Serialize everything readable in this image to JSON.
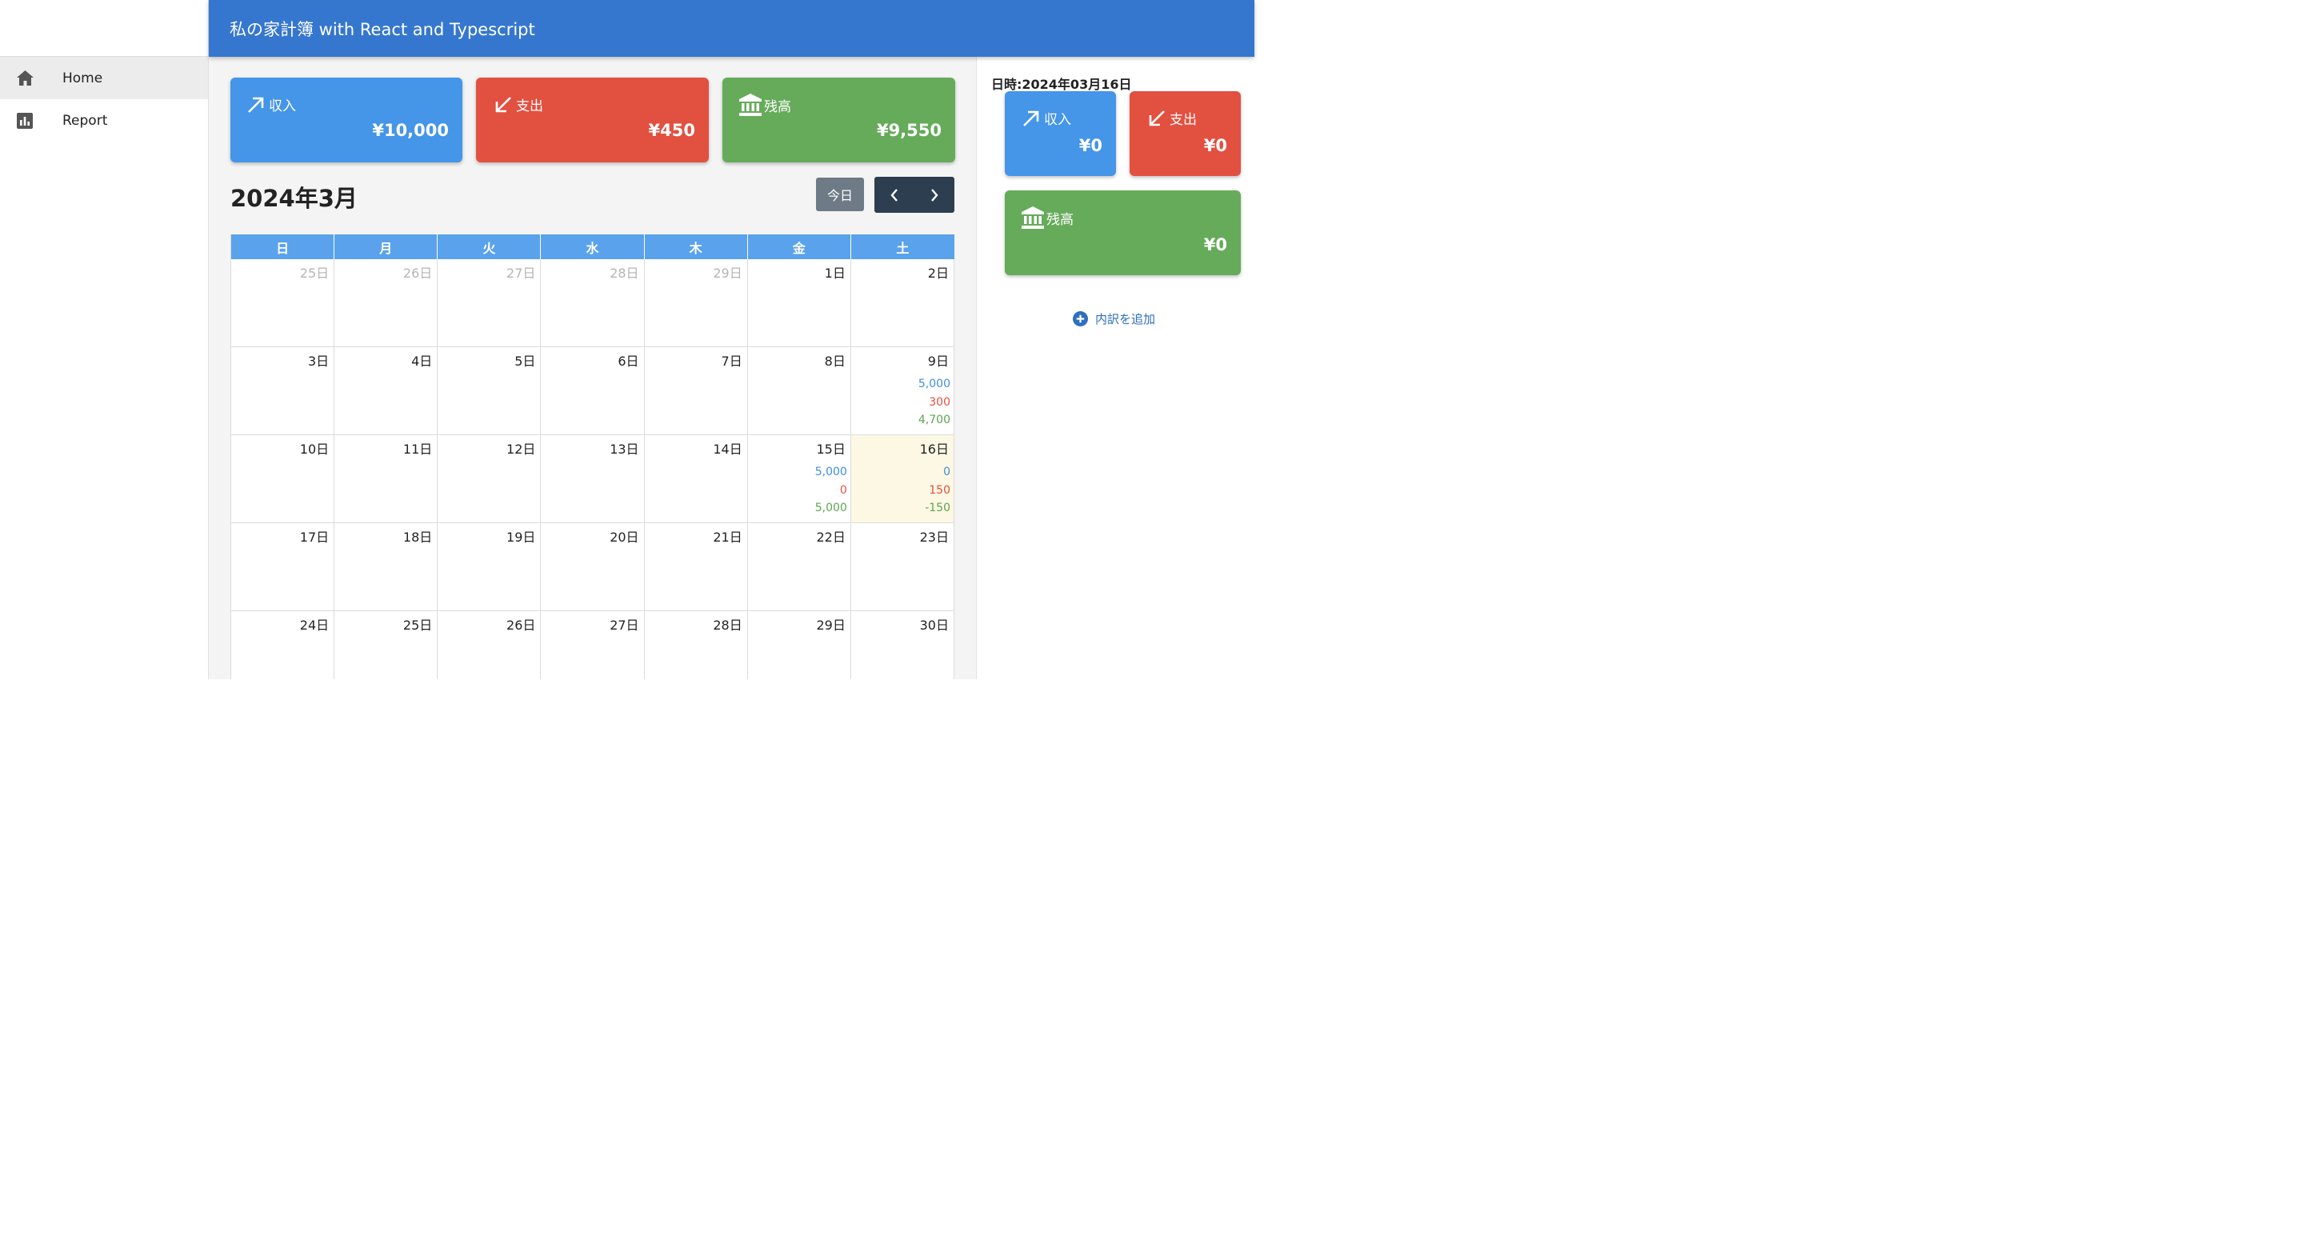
{
  "header": {
    "title": "私の家計簿 with React and Typescript"
  },
  "sidebar": {
    "items": [
      {
        "label": "Home",
        "icon": "home-icon",
        "active": true
      },
      {
        "label": "Report",
        "icon": "bar-chart-icon",
        "active": false
      }
    ]
  },
  "summary": {
    "income": {
      "label": "収入",
      "amount": "¥10,000"
    },
    "expense": {
      "label": "支出",
      "amount": "¥450"
    },
    "balance": {
      "label": "残高",
      "amount": "¥9,550"
    }
  },
  "calendar": {
    "title": "2024年3月",
    "today_label": "今日",
    "weekdays": [
      "日",
      "月",
      "火",
      "水",
      "木",
      "金",
      "土"
    ],
    "weeks": [
      [
        {
          "day": "25日",
          "dim": true
        },
        {
          "day": "26日",
          "dim": true
        },
        {
          "day": "27日",
          "dim": true
        },
        {
          "day": "28日",
          "dim": true
        },
        {
          "day": "29日",
          "dim": true
        },
        {
          "day": "1日"
        },
        {
          "day": "2日"
        }
      ],
      [
        {
          "day": "3日"
        },
        {
          "day": "4日"
        },
        {
          "day": "5日"
        },
        {
          "day": "6日"
        },
        {
          "day": "7日"
        },
        {
          "day": "8日"
        },
        {
          "day": "9日",
          "income": "5,000",
          "expense": "300",
          "balance": "4,700"
        }
      ],
      [
        {
          "day": "10日"
        },
        {
          "day": "11日"
        },
        {
          "day": "12日"
        },
        {
          "day": "13日"
        },
        {
          "day": "14日"
        },
        {
          "day": "15日",
          "income": "5,000",
          "expense": "0",
          "balance": "5,000"
        },
        {
          "day": "16日",
          "today": true,
          "income": "0",
          "expense": "150",
          "balance": "-150"
        }
      ],
      [
        {
          "day": "17日"
        },
        {
          "day": "18日"
        },
        {
          "day": "19日"
        },
        {
          "day": "20日"
        },
        {
          "day": "21日"
        },
        {
          "day": "22日"
        },
        {
          "day": "23日"
        }
      ],
      [
        {
          "day": "24日"
        },
        {
          "day": "25日"
        },
        {
          "day": "26日"
        },
        {
          "day": "27日"
        },
        {
          "day": "28日"
        },
        {
          "day": "29日"
        },
        {
          "day": "30日"
        }
      ]
    ]
  },
  "daily": {
    "date_label": "日時:2024年03月16日",
    "income": {
      "label": "収入",
      "amount": "¥0"
    },
    "expense": {
      "label": "支出",
      "amount": "¥0"
    },
    "balance": {
      "label": "残高",
      "amount": "¥0"
    },
    "add_label": "内訳を追加"
  },
  "colors": {
    "header": "#3577cf",
    "income": "#4595e8",
    "expense": "#e25040",
    "balance": "#66ab5a",
    "today_bg": "#fdf8e3"
  }
}
